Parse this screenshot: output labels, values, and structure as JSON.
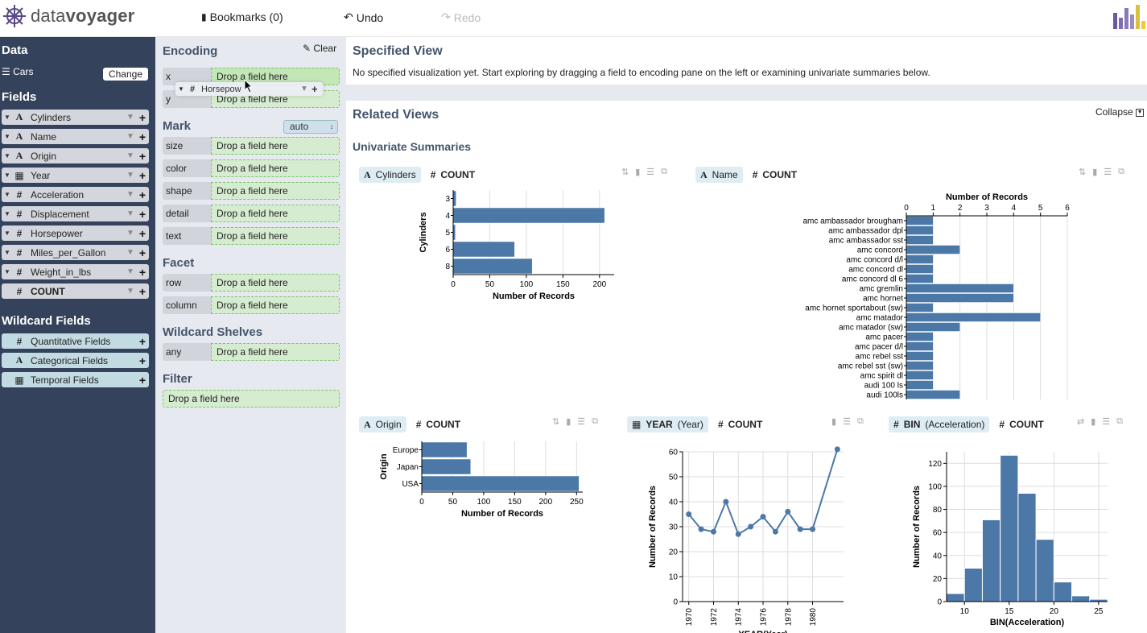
{
  "header": {
    "logo_data": "data",
    "logo_voyager": "voyager",
    "bookmarks": "Bookmarks (0)",
    "undo": "Undo",
    "redo": "Redo"
  },
  "sidebar": {
    "data_title": "Data",
    "dataset": "Cars",
    "change": "Change",
    "fields_title": "Fields",
    "fields": [
      {
        "name": "Cylinders",
        "type": "A"
      },
      {
        "name": "Name",
        "type": "A"
      },
      {
        "name": "Origin",
        "type": "A"
      },
      {
        "name": "Year",
        "type": "calendar"
      },
      {
        "name": "Acceleration",
        "type": "#"
      },
      {
        "name": "Displacement",
        "type": "#"
      },
      {
        "name": "Horsepower",
        "type": "#"
      },
      {
        "name": "Miles_per_Gallon",
        "type": "#"
      },
      {
        "name": "Weight_in_lbs",
        "type": "#"
      },
      {
        "name": "COUNT",
        "type": "#"
      }
    ],
    "wildcard_title": "Wildcard Fields",
    "wildcards": [
      {
        "name": "Quantitative Fields",
        "type": "#"
      },
      {
        "name": "Categorical Fields",
        "type": "A"
      },
      {
        "name": "Temporal Fields",
        "type": "calendar"
      }
    ]
  },
  "encoding": {
    "title": "Encoding",
    "clear": "Clear",
    "drop_placeholder": "Drop a field here",
    "dragging_field": "Horsepow",
    "positional": [
      "x",
      "y"
    ],
    "mark_title": "Mark",
    "mark_value": "auto",
    "mark_channels": [
      "size",
      "color",
      "shape",
      "detail",
      "text"
    ],
    "facet_title": "Facet",
    "facet_channels": [
      "row",
      "column"
    ],
    "wildcard_title": "Wildcard Shelves",
    "wildcard_channels": [
      "any"
    ],
    "filter_title": "Filter"
  },
  "main": {
    "specified_title": "Specified View",
    "specified_msg": "No specified visualization yet. Start exploring by dragging a field to encoding pane on the left or examining univariate summaries below.",
    "related_title": "Related Views",
    "collapse": "Collapse",
    "univariate_title": "Univariate Summaries",
    "count_label": "COUNT"
  },
  "chart_data": [
    {
      "type": "bar",
      "field_tag": "Cylinders",
      "categories": [
        "3",
        "4",
        "5",
        "6",
        "8"
      ],
      "values": [
        4,
        207,
        3,
        84,
        108
      ],
      "xlabel": "Number of Records",
      "ylabel": "Cylinders",
      "xlim": [
        0,
        220
      ],
      "xticks": [
        0,
        50,
        100,
        150,
        200
      ]
    },
    {
      "type": "bar",
      "field_tag": "Name",
      "title": "Number of Records",
      "categories": [
        "amc ambassador brougham",
        "amc ambassador dpl",
        "amc ambassador sst",
        "amc concord",
        "amc concord d/l",
        "amc concord dl",
        "amc concord dl 6",
        "amc gremlin",
        "amc hornet",
        "amc hornet sportabout (sw)",
        "amc matador",
        "amc matador (sw)",
        "amc pacer",
        "amc pacer d/l",
        "amc rebel sst",
        "amc rebel sst (sw)",
        "amc spirit dl",
        "audi 100 ls",
        "audi 100ls"
      ],
      "values": [
        1,
        1,
        1,
        2,
        1,
        1,
        1,
        4,
        4,
        1,
        5,
        2,
        1,
        1,
        1,
        1,
        1,
        1,
        2
      ],
      "xlim": [
        0,
        6
      ],
      "xticks": [
        0,
        1,
        2,
        3,
        4,
        5,
        6
      ]
    },
    {
      "type": "bar",
      "field_tag": "Origin",
      "categories": [
        "Europe",
        "Japan",
        "USA"
      ],
      "values": [
        73,
        79,
        254
      ],
      "xlabel": "Number of Records",
      "ylabel": "Origin",
      "xlim": [
        0,
        260
      ],
      "xticks": [
        0,
        50,
        100,
        150,
        200,
        250
      ]
    },
    {
      "type": "line",
      "field_tag_prefix": "YEAR",
      "field_tag": "(Year)",
      "x": [
        1970,
        1971,
        1972,
        1973,
        1974,
        1975,
        1976,
        1977,
        1978,
        1979,
        1980,
        1982
      ],
      "y": [
        35,
        29,
        28,
        40,
        27,
        30,
        34,
        28,
        36,
        29,
        29,
        61
      ],
      "xticks": [
        1970,
        1972,
        1974,
        1976,
        1978,
        1980
      ],
      "ylabel": "Number of Records",
      "xlabel": "YEAR(Year)",
      "ylim": [
        0,
        60
      ],
      "yticks": [
        0,
        10,
        20,
        30,
        40,
        50,
        60
      ]
    },
    {
      "type": "bar",
      "field_tag_prefix": "BIN",
      "field_tag": "(Acceleration)",
      "bins": [
        8,
        10,
        12,
        14,
        16,
        18,
        20,
        22,
        24,
        26
      ],
      "values": [
        7,
        29,
        71,
        127,
        94,
        54,
        17,
        5,
        2
      ],
      "xticks": [
        10,
        15,
        20,
        25
      ],
      "ylabel": "Number of Records",
      "xlabel": "BIN(Acceleration)",
      "ylim": [
        0,
        130
      ],
      "yticks": [
        0,
        20,
        40,
        60,
        80,
        100,
        120
      ]
    }
  ],
  "colors": {
    "bar": "#4c78a8",
    "sidebar": "#34425c",
    "accent": "#44556b"
  }
}
